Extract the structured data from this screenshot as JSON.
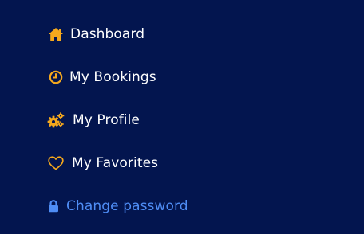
{
  "colors": {
    "background": "#03154f",
    "icon_accent": "#f5a81d",
    "text": "#ffffff",
    "link": "#4f8df5"
  },
  "menu": {
    "items": [
      {
        "label": "Dashboard",
        "icon": "home-icon"
      },
      {
        "label": "My Bookings",
        "icon": "clock-icon"
      },
      {
        "label": "My Profile",
        "icon": "gears-icon"
      },
      {
        "label": "My Favorites",
        "icon": "heart-icon"
      },
      {
        "label": "Change password",
        "icon": "lock-icon"
      }
    ]
  }
}
